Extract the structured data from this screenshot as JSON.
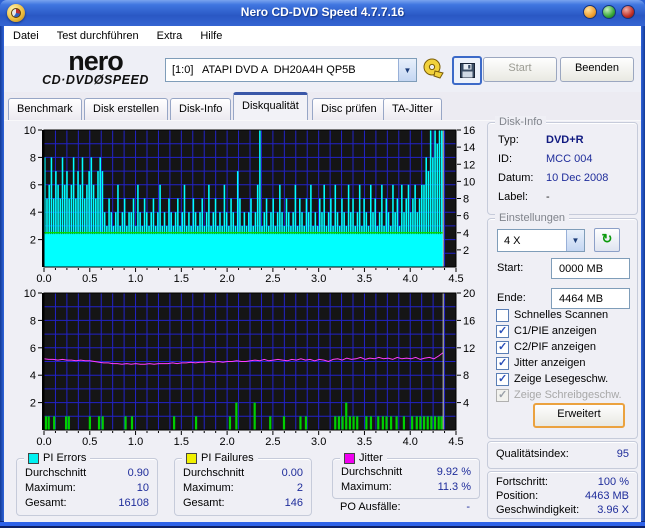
{
  "window": {
    "title": "Nero CD-DVD Speed 4.7.7.16"
  },
  "menu": {
    "items": [
      "Datei",
      "Test durchführen",
      "Extra",
      "Hilfe"
    ]
  },
  "toolbar": {
    "logo1": "nero",
    "logo2a": "CD·DVD",
    "logo2b": "Ø",
    "logo2c": "SPEED",
    "drive": "[1:0]   ATAPI DVD A  DH20A4H QP5B",
    "start_label": "Start",
    "quit_label": "Beenden"
  },
  "tabs": [
    {
      "label": "Benchmark",
      "active": false
    },
    {
      "label": "Disk erstellen",
      "active": false
    },
    {
      "label": "Disk-Info",
      "active": false
    },
    {
      "label": "Diskqualität",
      "active": true
    },
    {
      "label": "Disc prüfen",
      "active": false
    },
    {
      "label": "TA-Jitter",
      "active": false
    }
  ],
  "disk_info": {
    "title": "Disk-Info",
    "rows": [
      {
        "label": "Typ:",
        "value": "DVD+R"
      },
      {
        "label": "ID:",
        "value": "MCC 004"
      },
      {
        "label": "Datum:",
        "value": "10 Dec 2008"
      },
      {
        "label": "Label:",
        "value": "-"
      }
    ]
  },
  "settings": {
    "title": "Einstellungen",
    "speed": "4 X",
    "refresh_icon": "↻",
    "start_label": "Start:",
    "start_value": "0000 MB",
    "end_label": "Ende:",
    "end_value": "4464 MB",
    "checkboxes": [
      {
        "label": "Schnelles Scannen",
        "checked": false,
        "disabled": false
      },
      {
        "label": "C1/PIE anzeigen",
        "checked": true,
        "disabled": false
      },
      {
        "label": "C2/PIF anzeigen",
        "checked": true,
        "disabled": false
      },
      {
        "label": "Jitter anzeigen",
        "checked": true,
        "disabled": false
      },
      {
        "label": "Zeige Lesegeschw.",
        "checked": true,
        "disabled": false
      },
      {
        "label": "Zeige Schreibgeschw.",
        "checked": true,
        "disabled": true
      }
    ],
    "advanced_label": "Erweitert"
  },
  "quality": {
    "label": "Qualitätsindex:",
    "value": "95"
  },
  "progress": {
    "rows": [
      {
        "label": "Fortschritt:",
        "value": "100 %"
      },
      {
        "label": "Position:",
        "value": "4463 MB"
      },
      {
        "label": "Geschwindigkeit:",
        "value": "3.96 X"
      }
    ]
  },
  "stats": {
    "pi_errors": {
      "title": "PI Errors",
      "legend_color": "#00f0f0",
      "rows": [
        {
          "label": "Durchschnitt",
          "value": "0.90"
        },
        {
          "label": "Maximum:",
          "value": "10"
        },
        {
          "label": "Gesamt:",
          "value": "16108"
        }
      ]
    },
    "pi_failures": {
      "title": "PI Failures",
      "legend_color": "#f0f000",
      "rows": [
        {
          "label": "Durchschnitt",
          "value": "0.00"
        },
        {
          "label": "Maximum:",
          "value": "2"
        },
        {
          "label": "Gesamt:",
          "value": "146"
        }
      ]
    },
    "jitter": {
      "title": "Jitter",
      "legend_color": "#f000f0",
      "rows": [
        {
          "label": "Durchschnitt",
          "value": "9.92 %"
        },
        {
          "label": "Maximum:",
          "value": "11.3 %"
        }
      ]
    },
    "po": {
      "label": "PO Ausfälle:",
      "value": "-"
    }
  },
  "chart_data": [
    {
      "type": "bar",
      "title": "PI Errors vs. Position (GB)",
      "xmax": 4.5,
      "x_grid_step": 0.125,
      "xtick_step": 0.5,
      "ylim_left": [
        0,
        10
      ],
      "yticks_left": [
        2,
        4,
        6,
        8,
        10
      ],
      "ylim_right": [
        0,
        16
      ],
      "yticks_right": [
        2,
        4,
        6,
        8,
        10,
        12,
        14,
        16
      ],
      "cursor_x": 4.36,
      "bg": "#151515",
      "grid_color": "#2222c8",
      "series": [
        {
          "name": "PI Errors",
          "type": "bars",
          "color": "#00ffff",
          "ymax": 10,
          "x_start": 0,
          "x_end": 4.36,
          "base": 2.4,
          "values": [
            8,
            5,
            6,
            8,
            5,
            7,
            6,
            5,
            8,
            6,
            7,
            5,
            6,
            8,
            5,
            7,
            6,
            8,
            5,
            6,
            7,
            8,
            6,
            5,
            7,
            8,
            7,
            4,
            3,
            5,
            4,
            3,
            4,
            6,
            3,
            4,
            5,
            3,
            4,
            4,
            5,
            3,
            6,
            4,
            3,
            5,
            4,
            3,
            4,
            5,
            3,
            4,
            6,
            3,
            4,
            3,
            5,
            4,
            3,
            4,
            5,
            3,
            4,
            6,
            3,
            4,
            3,
            5,
            4,
            3,
            4,
            5,
            3,
            4,
            6,
            3,
            4,
            5,
            3,
            4,
            3,
            6,
            4,
            3,
            5,
            4,
            3,
            7,
            5,
            3,
            4,
            3,
            4,
            5,
            3,
            4,
            6,
            10,
            3,
            4,
            5,
            3,
            4,
            5,
            3,
            4,
            6,
            4,
            3,
            5,
            4,
            3,
            4,
            6,
            3,
            5,
            4,
            3,
            5,
            4,
            6,
            3,
            4,
            3,
            5,
            4,
            6,
            3,
            4,
            5,
            3,
            6,
            4,
            3,
            5,
            4,
            3,
            6,
            4,
            5,
            3,
            4,
            6,
            3,
            5,
            4,
            3,
            6,
            4,
            5,
            3,
            4,
            6,
            3,
            5,
            4,
            3,
            6,
            4,
            5,
            3,
            6,
            4,
            5,
            6,
            4,
            5,
            6,
            4,
            5,
            6,
            6,
            8,
            7,
            10,
            8,
            10,
            9,
            10,
            10
          ]
        },
        {
          "name": "Lesegeschwindigkeit",
          "type": "hline",
          "color": "#00dd00",
          "axis_max": 16,
          "value": 4,
          "x_end": 4.36
        }
      ]
    },
    {
      "type": "mixed",
      "title": "PI Failures & Jitter vs. Position (GB)",
      "xmax": 4.5,
      "x_grid_step": 0.125,
      "xtick_step": 0.5,
      "ylim_left": [
        0,
        10
      ],
      "yticks_left": [
        2,
        4,
        6,
        8,
        10
      ],
      "ylim_right": [
        0,
        20
      ],
      "yticks_right": [
        4,
        8,
        12,
        16,
        20
      ],
      "cursor_x": 4.36,
      "bg": "#151515",
      "grid_color": "#2222c8",
      "series": [
        {
          "name": "PI Failures",
          "type": "points",
          "color": "#00d000",
          "ymax": 10,
          "points": [
            [
              0.02,
              1
            ],
            [
              0.05,
              1
            ],
            [
              0.11,
              1
            ],
            [
              0.24,
              1
            ],
            [
              0.27,
              1
            ],
            [
              0.5,
              1
            ],
            [
              0.6,
              1
            ],
            [
              0.64,
              1
            ],
            [
              0.89,
              1
            ],
            [
              0.96,
              1
            ],
            [
              1.42,
              1
            ],
            [
              1.66,
              1
            ],
            [
              2.03,
              1
            ],
            [
              2.1,
              2
            ],
            [
              2.3,
              2
            ],
            [
              2.47,
              1
            ],
            [
              2.62,
              1
            ],
            [
              2.8,
              1
            ],
            [
              2.86,
              1
            ],
            [
              3.18,
              1
            ],
            [
              3.22,
              1
            ],
            [
              3.26,
              1
            ],
            [
              3.3,
              2
            ],
            [
              3.34,
              1
            ],
            [
              3.38,
              1
            ],
            [
              3.42,
              1
            ],
            [
              3.52,
              1
            ],
            [
              3.57,
              1
            ],
            [
              3.65,
              1
            ],
            [
              3.7,
              1
            ],
            [
              3.74,
              1
            ],
            [
              3.79,
              1
            ],
            [
              3.85,
              1
            ],
            [
              3.93,
              1
            ],
            [
              4.02,
              1
            ],
            [
              4.07,
              1
            ],
            [
              4.11,
              1
            ],
            [
              4.15,
              1
            ],
            [
              4.19,
              1
            ],
            [
              4.23,
              1
            ],
            [
              4.27,
              1
            ],
            [
              4.31,
              1
            ],
            [
              4.34,
              1
            ]
          ]
        },
        {
          "name": "Jitter",
          "type": "line",
          "color": "#ff3cff",
          "axis_max": 20,
          "x_start": 0,
          "x_end": 4.36,
          "values": [
            10.4,
            10.3,
            10.3,
            10.2,
            10.3,
            10.2,
            10.2,
            10.1,
            10.2,
            10.1,
            10.1,
            10.0,
            9.9,
            9.8,
            9.8,
            9.7,
            9.7,
            9.6,
            9.7,
            9.6,
            9.7,
            9.6,
            9.6,
            9.7,
            9.6,
            9.7,
            9.7,
            9.7,
            9.8,
            9.7,
            9.8,
            9.8,
            9.9,
            9.8,
            9.9,
            9.9,
            10.0,
            9.9,
            10.0,
            9.9,
            10.0,
            10.0,
            10.1,
            10.0,
            10.0,
            10.1,
            10.2,
            10.1,
            10.3,
            10.1,
            10.2,
            10.3,
            10.2,
            10.1,
            10.3,
            10.2,
            10.4,
            10.2,
            10.3,
            10.1,
            10.3,
            10.2,
            10.0,
            10.3,
            10.4,
            10.2,
            10.5,
            10.3,
            10.4,
            10.6,
            10.3,
            10.5,
            10.4,
            10.6,
            10.4,
            10.5,
            10.3,
            10.6,
            10.4,
            10.5,
            10.4,
            10.6,
            10.3,
            10.5,
            10.6,
            10.4,
            10.8,
            11.3
          ]
        }
      ]
    }
  ]
}
